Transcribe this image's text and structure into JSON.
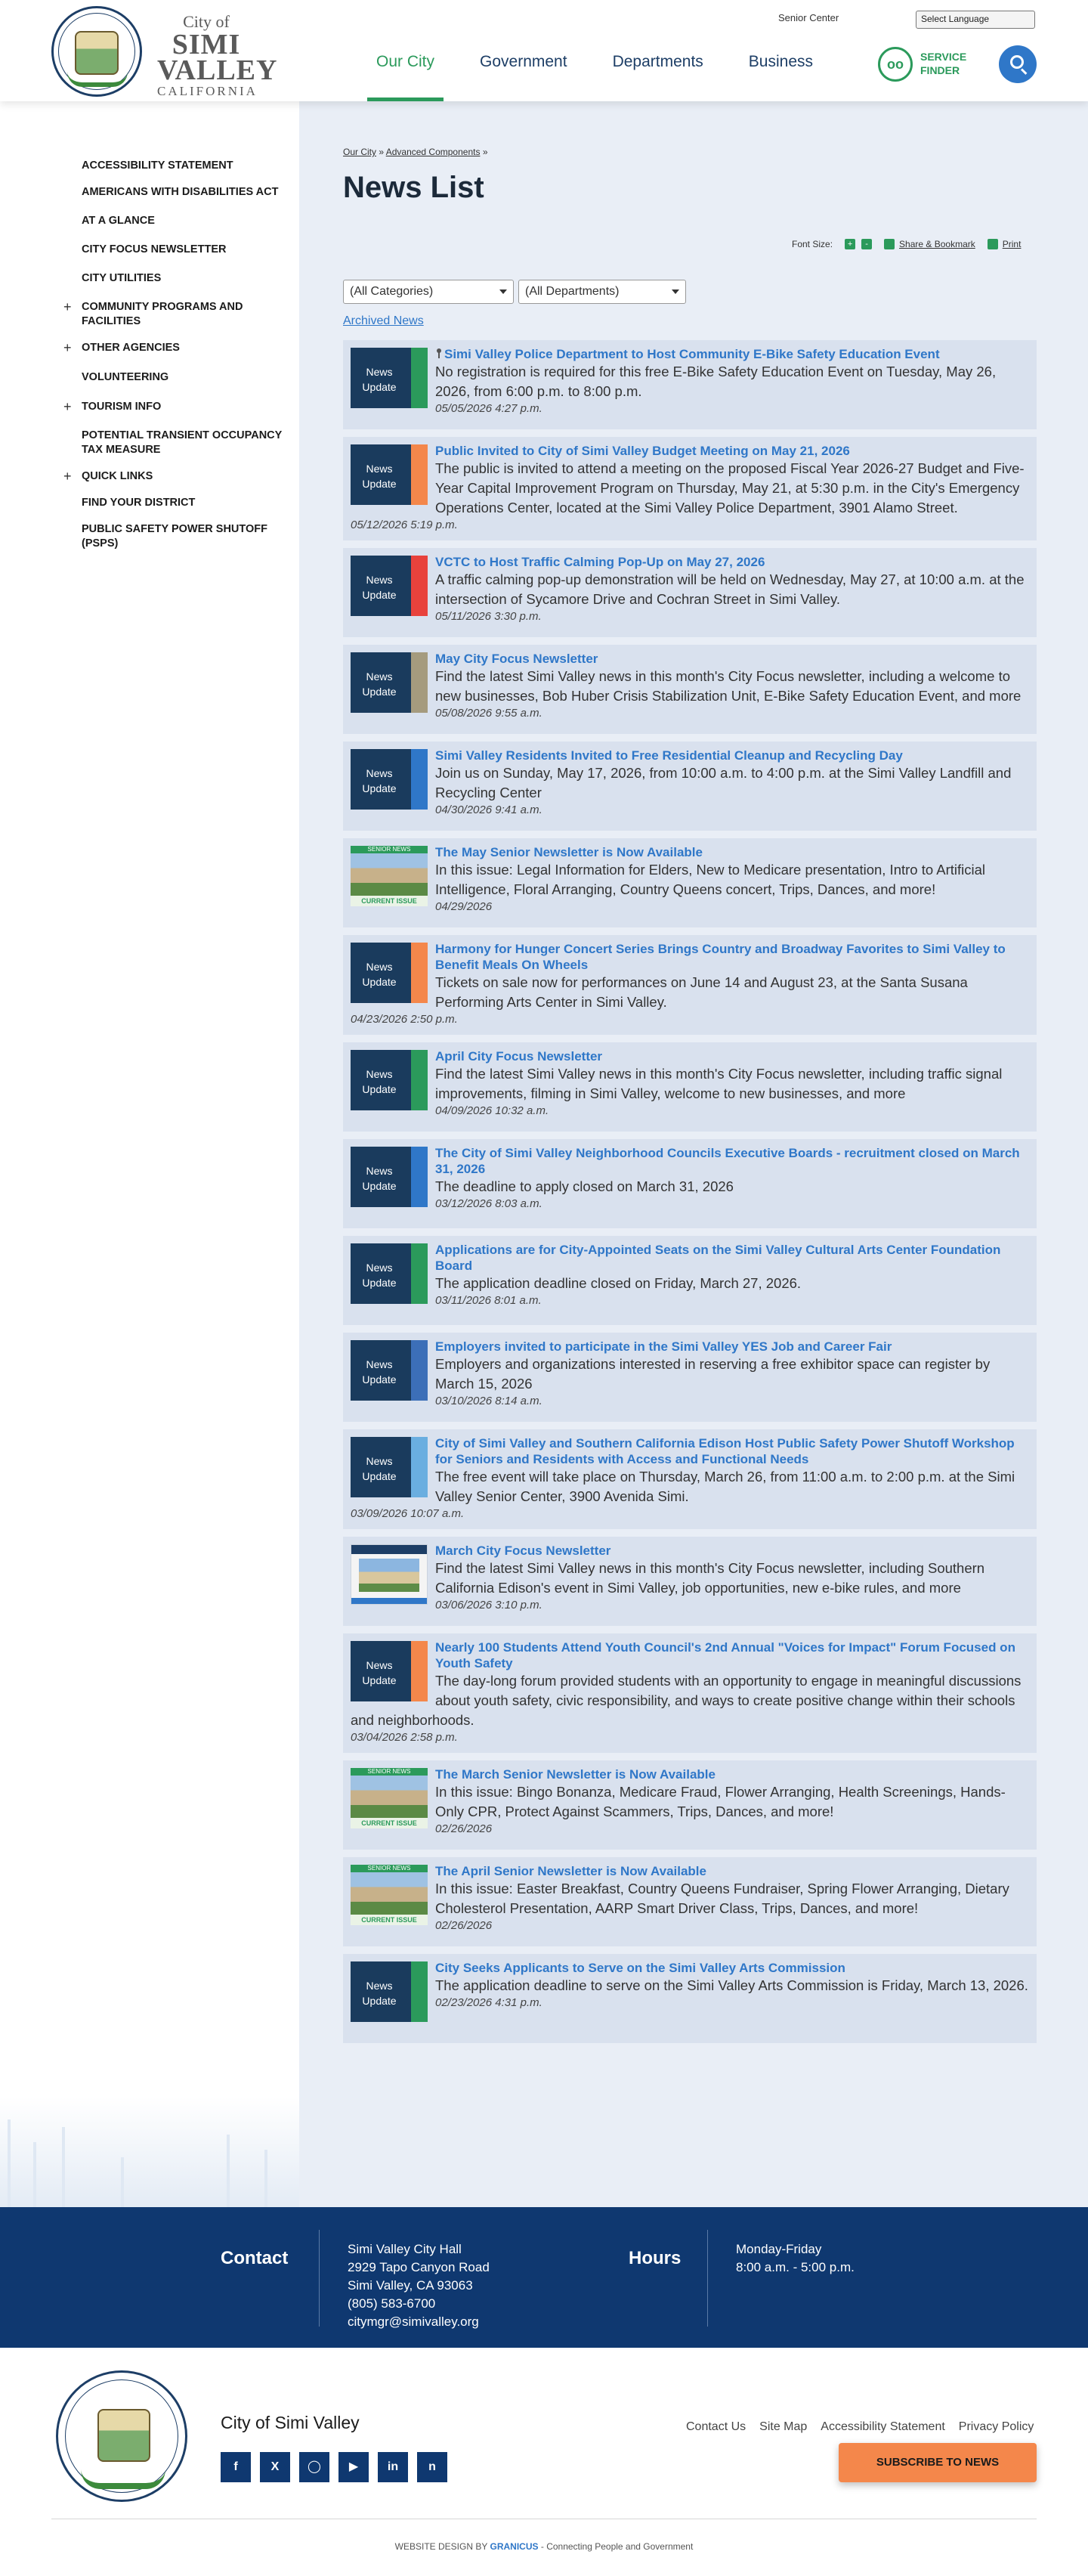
{
  "header": {
    "logo": {
      "city_of": "City of",
      "name": "SIMI VALLEY",
      "state": "CALIFORNIA"
    },
    "utility_link": "Senior Center",
    "language_select": "Select Language",
    "nav": [
      "Our City",
      "Government",
      "Departments",
      "Business"
    ],
    "service_finder": {
      "line1": "SERVICE",
      "line2": "FINDER"
    },
    "colors": {
      "navy": "#1d3e66",
      "green": "#2b9a5b",
      "blue": "#2f77c8"
    }
  },
  "sidebar": {
    "items": [
      {
        "label": "ACCESSIBILITY STATEMENT",
        "expandable": false
      },
      {
        "label": "AMERICANS WITH DISABILITIES ACT",
        "expandable": false
      },
      {
        "label": "AT A GLANCE",
        "expandable": false
      },
      {
        "label": "CITY FOCUS NEWSLETTER",
        "expandable": false
      },
      {
        "label": "CITY UTILITIES",
        "expandable": false
      },
      {
        "label": "COMMUNITY PROGRAMS AND FACILITIES",
        "expandable": true
      },
      {
        "label": "OTHER AGENCIES",
        "expandable": true
      },
      {
        "label": "VOLUNTEERING",
        "expandable": false
      },
      {
        "label": "TOURISM INFO",
        "expandable": true
      },
      {
        "label": "POTENTIAL TRANSIENT OCCUPANCY TAX MEASURE",
        "expandable": false
      },
      {
        "label": "QUICK LINKS",
        "expandable": true
      },
      {
        "label": "FIND YOUR DISTRICT",
        "expandable": false
      },
      {
        "label": "PUBLIC SAFETY POWER SHUTOFF (PSPS)",
        "expandable": false
      }
    ]
  },
  "main": {
    "breadcrumb": [
      "Our City",
      "Advanced Components"
    ],
    "breadcrumb_sep": "»",
    "title": "News List",
    "tools": {
      "font_size": "Font Size:",
      "plus": "+",
      "minus": "-",
      "share": "Share & Bookmark",
      "print": "Print"
    },
    "filters": {
      "category": "(All Categories)",
      "department": "(All Departments)"
    },
    "archived": "Archived News",
    "thumb_labels": {
      "news": "News Update",
      "senior_banner": "SENIOR NEWS",
      "senior_issue": "CURRENT ISSUE"
    },
    "news": [
      {
        "title": "Simi Valley Police Department to Host Community E-Bike Safety Education Event",
        "desc": "No registration is required for this free E-Bike Safety Education Event on Tuesday, May 26, 2026, from 6:00 p.m. to 8:00 p.m.",
        "date": "05/05/2026 4:27 p.m.",
        "thumb": "news",
        "bar": "#2b9a5b",
        "pinned": true
      },
      {
        "title": "Public Invited to City of Simi Valley Budget Meeting on May 21, 2026",
        "desc": "The public is invited to attend a meeting on the proposed Fiscal Year 2026-27 Budget and Five-Year Capital Improvement Program on Thursday, May 21, at 5:30 p.m. in the City's Emergency Operations Center, located at the Simi Valley Police Department, 3901 Alamo Street.",
        "date": "05/12/2026 5:19 p.m.",
        "thumb": "news",
        "bar": "#f4874b"
      },
      {
        "title": "VCTC to Host Traffic Calming Pop-Up on May 27, 2026",
        "desc": "A traffic calming pop-up demonstration will be held on Wednesday, May 27, at 10:00 a.m. at the intersection of Sycamore Drive and Cochran Street in Simi Valley.",
        "date": "05/11/2026 3:30 p.m.",
        "thumb": "news",
        "bar": "#e8423c"
      },
      {
        "title": "May City Focus Newsletter",
        "desc": "Find the latest Simi Valley news in this month's City Focus newsletter, including a welcome to new businesses, Bob Huber Crisis Stabilization Unit, E-Bike Safety Education Event, and more",
        "date": "05/08/2026 9:55 a.m.",
        "thumb": "news",
        "bar": "#a59b7e"
      },
      {
        "title": "Simi Valley Residents Invited to Free Residential Cleanup and Recycling Day",
        "desc": "Join us on Sunday, May 17, 2026, from 10:00 a.m. to 4:00 p.m. at the Simi Valley Landfill and Recycling Center",
        "date": "04/30/2026 9:41 a.m.",
        "thumb": "news",
        "bar": "#2f77c8"
      },
      {
        "title": "The May Senior Newsletter is Now Available",
        "desc": "In this issue: Legal Information for Elders, New to Medicare presentation, Intro to Artificial Intelligence, Floral Arranging, Country Queens concert, Trips, Dances, and more!",
        "date": "04/29/2026",
        "thumb": "senior",
        "bar": ""
      },
      {
        "title": "Harmony for Hunger Concert Series Brings Country and Broadway Favorites to Simi Valley to Benefit Meals On Wheels",
        "desc": "Tickets on sale now for performances on June 14 and August 23, at the Santa Susana Performing Arts Center in Simi Valley.",
        "date": "04/23/2026 2:50 p.m.",
        "thumb": "news",
        "bar": "#f4874b"
      },
      {
        "title": "April City Focus Newsletter",
        "desc": "Find the latest Simi Valley news in this month's City Focus newsletter, including traffic signal improvements, filming in Simi Valley, welcome to new businesses, and more",
        "date": "04/09/2026 10:32 a.m.",
        "thumb": "news",
        "bar": "#2b9a5b"
      },
      {
        "title": "The City of Simi Valley Neighborhood Councils Executive Boards - recruitment closed on March 31, 2026",
        "desc": "The deadline to apply closed on March 31, 2026",
        "date": "03/12/2026 8:03 a.m.",
        "thumb": "news",
        "bar": "#2f77c8"
      },
      {
        "title": "Applications are for City-Appointed Seats on the Simi Valley Cultural Arts Center Foundation Board",
        "desc": "The application deadline closed on Friday, March 27, 2026.",
        "date": "03/11/2026 8:01 a.m.",
        "thumb": "news",
        "bar": "#2b9a5b"
      },
      {
        "title": "Employers invited to participate in the Simi Valley YES Job and Career Fair",
        "desc": "Employers and organizations interested in reserving a free exhibitor space can register by March 15, 2026",
        "date": "03/10/2026 8:14 a.m.",
        "thumb": "news",
        "bar": "#3c6fb8"
      },
      {
        "title": "City of Simi Valley and Southern California Edison Host Public Safety Power Shutoff Workshop for Seniors and Residents with Access and Functional Needs",
        "desc": "The free event will take place on Thursday, March 26, from 11:00 a.m. to 2:00 p.m. at the Simi Valley Senior Center, 3900 Avenida Simi.",
        "date": "03/09/2026 10:07 a.m.",
        "thumb": "news",
        "bar": "#6aaee0"
      },
      {
        "title": "March City Focus Newsletter",
        "desc": "Find the latest Simi Valley news in this month's City Focus newsletter, including Southern California Edison's event in Simi Valley, job opportunities, new e-bike rules, and more",
        "date": "03/06/2026 3:10 p.m.",
        "thumb": "focus",
        "bar": ""
      },
      {
        "title": "Nearly 100 Students Attend Youth Council's 2nd Annual \"Voices for Impact\" Forum Focused on Youth Safety",
        "desc": "The day-long forum provided students with an opportunity to engage in meaningful discussions about youth safety, civic responsibility, and ways to create positive change within their schools and neighborhoods.",
        "date": "03/04/2026 2:58 p.m.",
        "thumb": "news",
        "bar": "#f4874b"
      },
      {
        "title": "The March Senior Newsletter is Now Available",
        "desc": "In this issue: Bingo Bonanza, Medicare Fraud, Flower Arranging, Health Screenings, Hands-Only CPR, Protect Against Scammers, Trips, Dances, and more!",
        "date": "02/26/2026",
        "thumb": "senior",
        "bar": ""
      },
      {
        "title": "The April Senior Newsletter is Now Available",
        "desc": "In this issue: Easter Breakfast, Country Queens Fundraiser, Spring Flower Arranging, Dietary Cholesterol Presentation, AARP Smart Driver Class, Trips, Dances, and more!",
        "date": "02/26/2026",
        "thumb": "senior",
        "bar": ""
      },
      {
        "title": "City Seeks Applicants to Serve on the Simi Valley Arts Commission",
        "desc": "The application deadline to serve on the Simi Valley Arts Commission is Friday, March 13, 2026.",
        "date": "02/23/2026 4:31 p.m.",
        "thumb": "news",
        "bar": "#2b9a5b"
      }
    ]
  },
  "footer": {
    "contact_heading": "Contact",
    "contact_lines": [
      "Simi Valley City Hall",
      "2929 Tapo Canyon Road",
      "Simi Valley, CA 93063",
      "(805) 583-6700",
      "citymgr@simivalley.org"
    ],
    "hours_heading": "Hours",
    "hours_lines": [
      "Monday-Friday",
      "8:00 a.m. - 5:00 p.m."
    ],
    "city_name": "City of Simi Valley",
    "socials": [
      "facebook-icon",
      "x-icon",
      "instagram-icon",
      "youtube-icon",
      "linkedin-icon",
      "nextdoor-icon"
    ],
    "links": [
      "Contact Us",
      "Site Map",
      "Accessibility Statement",
      "Privacy Policy"
    ],
    "subscribe": "SUBSCRIBE TO NEWS",
    "credit_prefix": "WEBSITE DESIGN BY",
    "credit_brand": "GRANICUS",
    "credit_suffix": "- Connecting People and Government"
  }
}
